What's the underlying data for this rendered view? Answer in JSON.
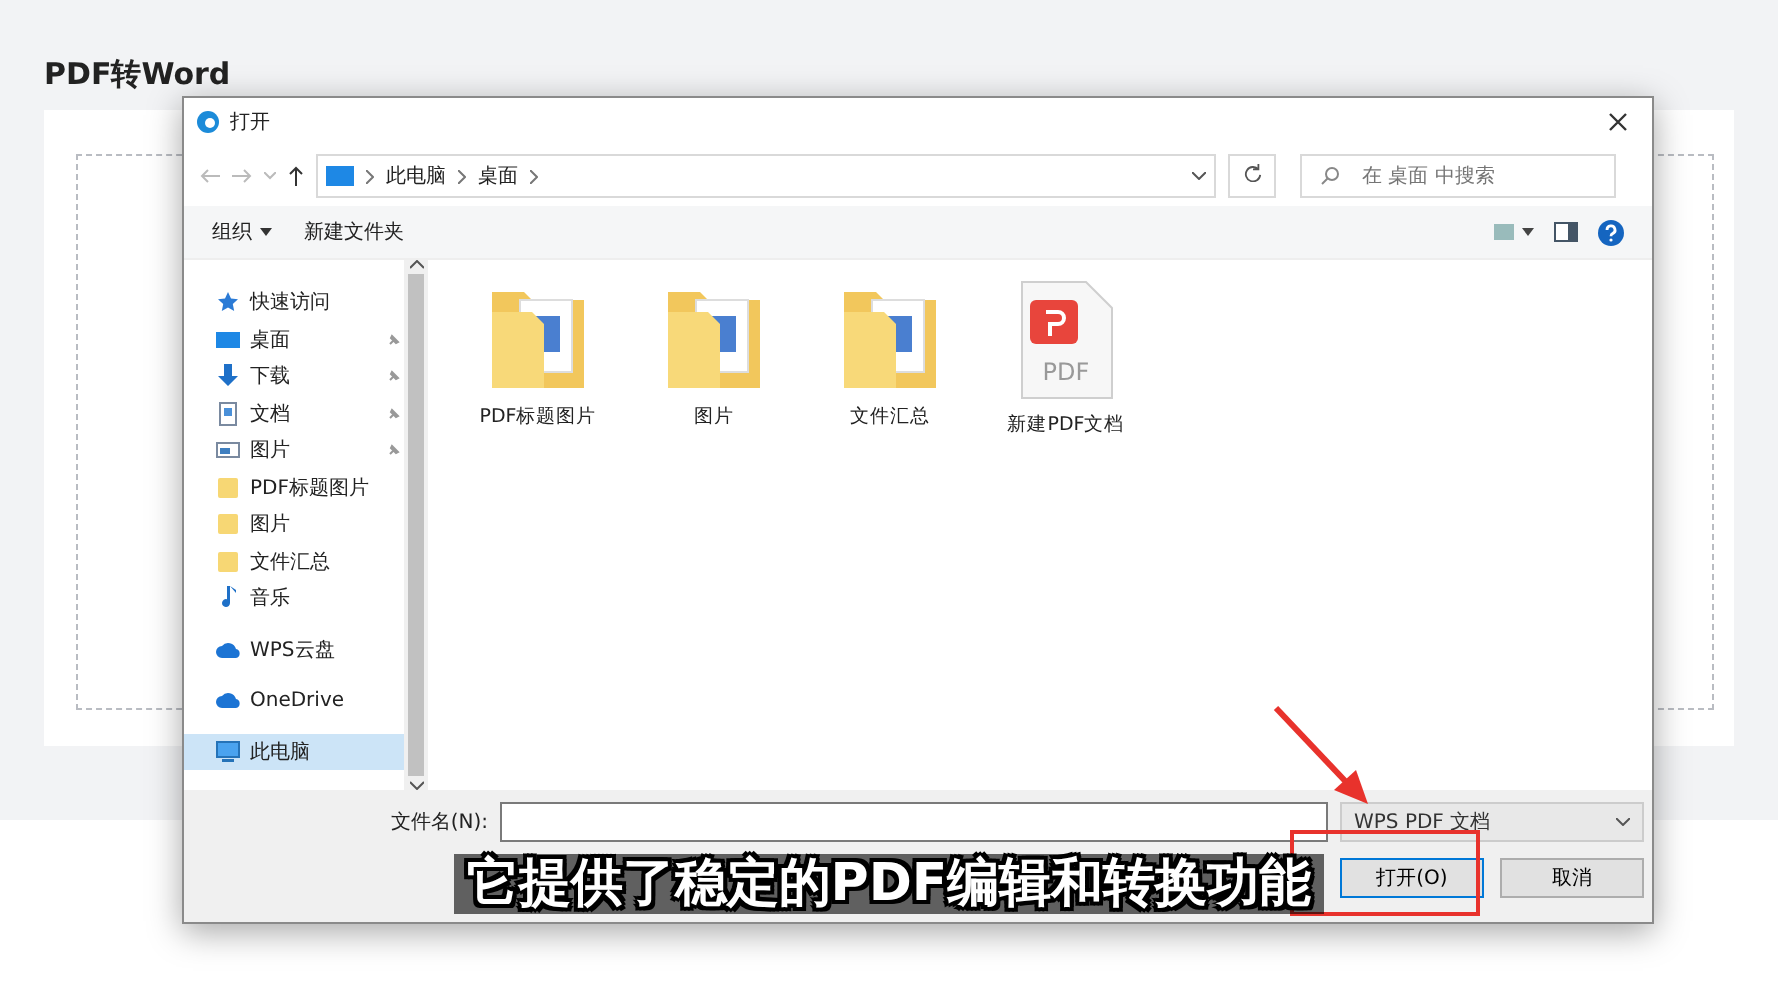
{
  "page": {
    "title": "PDF转Word"
  },
  "dialog": {
    "title": "打开",
    "address": {
      "crumbs": [
        "此电脑",
        "桌面"
      ]
    },
    "search": {
      "placeholder": "在 桌面 中搜索"
    },
    "toolbar": {
      "organize": "组织",
      "new_folder": "新建文件夹"
    },
    "sidebar": [
      {
        "label": "快速访问",
        "kind": "star",
        "pinned": false,
        "selected": false
      },
      {
        "label": "桌面",
        "kind": "desktop",
        "pinned": true,
        "selected": false
      },
      {
        "label": "下载",
        "kind": "download",
        "pinned": true,
        "selected": false
      },
      {
        "label": "文档",
        "kind": "document",
        "pinned": true,
        "selected": false
      },
      {
        "label": "图片",
        "kind": "picture",
        "pinned": true,
        "selected": false
      },
      {
        "label": "PDF标题图片",
        "kind": "folder",
        "pinned": false,
        "selected": false
      },
      {
        "label": "图片",
        "kind": "folder",
        "pinned": false,
        "selected": false
      },
      {
        "label": "文件汇总",
        "kind": "folder",
        "pinned": false,
        "selected": false
      },
      {
        "label": "音乐",
        "kind": "music",
        "pinned": false,
        "selected": false
      },
      {
        "label": "WPS云盘",
        "kind": "cloud",
        "pinned": false,
        "selected": false
      },
      {
        "label": "OneDrive",
        "kind": "cloud",
        "pinned": false,
        "selected": false
      },
      {
        "label": "此电脑",
        "kind": "computer",
        "pinned": false,
        "selected": true
      }
    ],
    "files": [
      {
        "name": "PDF标题图片",
        "kind": "folder"
      },
      {
        "name": "图片",
        "kind": "folder"
      },
      {
        "name": "文件汇总",
        "kind": "folder"
      },
      {
        "name": "新建PDF文档",
        "kind": "pdf",
        "icon_label": "PDF"
      }
    ],
    "filename": {
      "label": "文件名(N):"
    },
    "file_type": "WPS PDF 文档",
    "buttons": [
      {
        "label": "打开(O)",
        "kind": "primary"
      },
      {
        "label": "取消",
        "kind": "normal"
      }
    ]
  },
  "subtitle": "它提供了稳定的PDF编辑和转换功能"
}
